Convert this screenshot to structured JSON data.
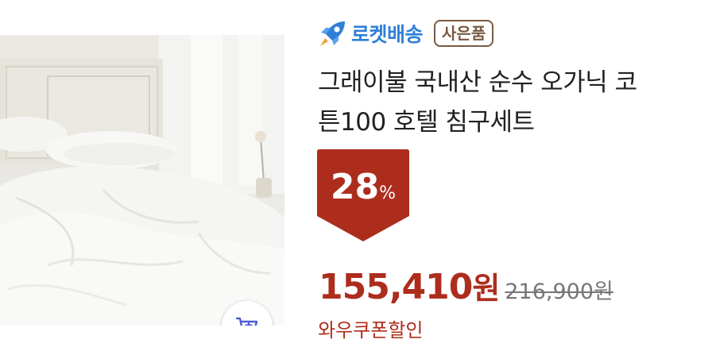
{
  "product": {
    "image_alt": "white bedding set",
    "delivery_badge": "로켓배송",
    "gift_badge": "사은품",
    "title_line1": "그래이불 국내산 순수 오가닉 코",
    "title_line2": "튼100 호텔 침구세트",
    "discount_value": "28",
    "discount_unit": "%",
    "sale_price": "155,410",
    "sale_price_unit": "원",
    "original_price": "216,900원",
    "coupon_text": "와우쿠폰할인"
  },
  "colors": {
    "accent_red": "#ad2d1d",
    "rocket_blue": "#2f7fd9",
    "gift_brown": "#7a5a41",
    "cart_purple": "#4b5dd6"
  },
  "icons": {
    "cart": "cart-plus-icon",
    "rocket": "rocket-icon"
  }
}
